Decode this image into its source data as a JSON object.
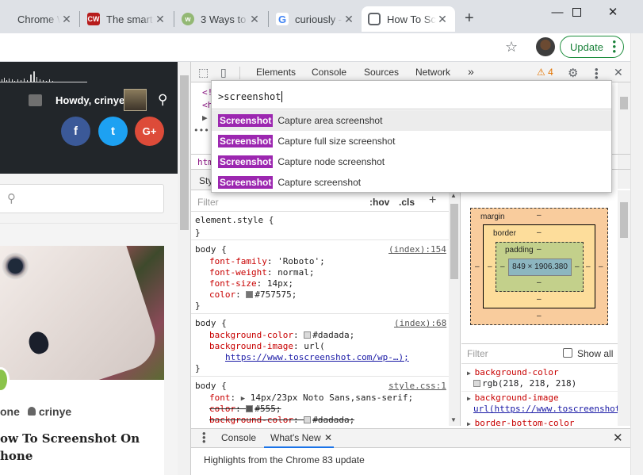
{
  "browser": {
    "tabs": [
      {
        "title": "Chrome W",
        "favicon": "chrome-icon",
        "color": "#4285f4"
      },
      {
        "title": "The smart",
        "favicon": "cw-icon",
        "color": "#b71c1c"
      },
      {
        "title": "3 Ways to",
        "favicon": "wikihow-icon",
        "color": "#93b874"
      },
      {
        "title": "curiously -",
        "favicon": "google-icon",
        "color": "#4285f4"
      },
      {
        "title": "How To Sc",
        "favicon": "camera-icon",
        "color": "#5f6368"
      }
    ],
    "new_tab": "+",
    "update_label": "Update"
  },
  "site": {
    "greeting": "Howdy, crinye",
    "social": {
      "facebook": "f",
      "twitter": "t",
      "gplus": "G+"
    },
    "post_category": "one",
    "post_author": "crinye",
    "post_title": "ow To Screenshot On hone"
  },
  "devtools": {
    "tabs": [
      "Elements",
      "Console",
      "Sources",
      "Network"
    ],
    "more": "»",
    "warnings": "4",
    "breadcrumb": "htm",
    "command_menu": {
      "query": ">screenshot",
      "items": [
        {
          "badge": "Screenshot",
          "label": "Capture area screenshot"
        },
        {
          "badge": "Screenshot",
          "label": "Capture full size screenshot"
        },
        {
          "badge": "Screenshot",
          "label": "Capture node screenshot"
        },
        {
          "badge": "Screenshot",
          "label": "Capture screenshot"
        }
      ]
    },
    "styles": {
      "tab_label": "Sty",
      "filter_placeholder": "Filter",
      "hov": ":hov",
      "cls": ".cls",
      "plus": "+",
      "element_style": "element.style {",
      "close_brace": "}",
      "rules": [
        {
          "selector": "body {",
          "source": "(index):154",
          "props": [
            {
              "name": "font-family",
              "value": "'Roboto';"
            },
            {
              "name": "font-weight",
              "value": "normal;"
            },
            {
              "name": "font-size",
              "value": "14px;"
            },
            {
              "name": "color",
              "value": "#757575;",
              "swatch": "#757575"
            }
          ]
        },
        {
          "selector": "body {",
          "source": "(index):68",
          "props": [
            {
              "name": "background-color",
              "value": "#dadada;",
              "swatch": "#dadada"
            },
            {
              "name": "background-image",
              "value": "url("
            },
            {
              "name": "",
              "value": "https://www.toscreenshot.com/wp-…);"
            }
          ]
        },
        {
          "selector": "body {",
          "source": "style.css:1",
          "props": [
            {
              "name": "font",
              "value": "14px/23px Noto Sans,sans-serif;"
            },
            {
              "name": "color",
              "value": "#555;",
              "swatch": "#555555"
            },
            {
              "name": "background-color",
              "value": "#dadada;",
              "swatch": "#dadada"
            }
          ]
        }
      ]
    },
    "box_model": {
      "margin_label": "margin",
      "border_label": "border",
      "padding_label": "padding",
      "content": "849 × 1906.380",
      "dash": "–",
      "colors": {
        "margin": "#f9cc9d",
        "border": "#fddd9b",
        "padding": "#c3d08b",
        "content": "#8cb6c0"
      }
    },
    "computed": {
      "filter_placeholder": "Filter",
      "show_all": "Show all",
      "props": [
        {
          "name": "background-color",
          "value": "rgb(218, 218, 218)"
        },
        {
          "name": "background-image",
          "value": "url(https://www.toscreenshot"
        },
        {
          "name": "border-bottom-color",
          "value": ""
        }
      ]
    },
    "drawer": {
      "tabs": [
        "Console",
        "What's New"
      ],
      "highlights": "Highlights from the Chrome 83 update"
    }
  }
}
